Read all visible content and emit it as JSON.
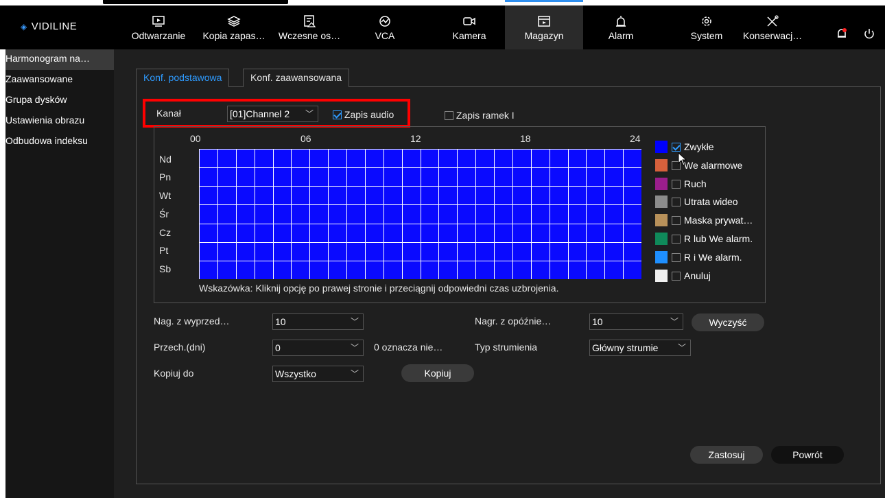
{
  "app": {
    "logo_text": "VIDILINE"
  },
  "nav": {
    "items": [
      {
        "label": "Odtwarzanie",
        "icon": "playback-icon"
      },
      {
        "label": "Kopia zapas…",
        "icon": "backup-icon"
      },
      {
        "label": "Wczesne os…",
        "icon": "early-warning-icon"
      },
      {
        "label": "VCA",
        "icon": "vca-icon"
      },
      {
        "label": "Kamera",
        "icon": "camera-icon"
      },
      {
        "label": "Magazyn",
        "icon": "storage-icon",
        "active": true
      },
      {
        "label": "Alarm",
        "icon": "alarm-icon"
      },
      {
        "label": "System",
        "icon": "system-gear-icon"
      },
      {
        "label": "Konserwacj…",
        "icon": "maintenance-tools-icon"
      }
    ],
    "notification_icon": "bell-icon",
    "power_icon": "power-icon"
  },
  "sidebar": {
    "items": [
      {
        "label": "Harmonogram na…",
        "selected": true
      },
      {
        "label": "Zaawansowane"
      },
      {
        "label": "Grupa dysków"
      },
      {
        "label": "Ustawienia obrazu"
      },
      {
        "label": "Odbudowa indeksu"
      }
    ]
  },
  "tabs": {
    "basic": "Konf. podstawowa",
    "advanced": "Konf. zaawansowana"
  },
  "channel": {
    "label": "Kanał",
    "value": "[01]Channel 2",
    "audio_label": "Zapis audio",
    "audio_checked": true,
    "iframe_label": "Zapis ramek I",
    "iframe_checked": false
  },
  "schedule": {
    "hours": [
      "00",
      "06",
      "12",
      "18",
      "24"
    ],
    "days": [
      "Nd",
      "Pn",
      "Wt",
      "Śr",
      "Cz",
      "Pt",
      "Sb"
    ],
    "hint": "Wskazówka: Kliknij opcję po prawej stronie i przeciągnij odpowiedni czas uzbrojenia.",
    "legend": [
      {
        "label": "Zwykłe",
        "color": "#0000ff",
        "checked": true
      },
      {
        "label": "We alarmowe",
        "color": "#d6603c",
        "checked": false
      },
      {
        "label": "Ruch",
        "color": "#9b1e8c",
        "checked": false
      },
      {
        "label": "Utrata wideo",
        "color": "#8c8c8c",
        "checked": false
      },
      {
        "label": "Maska prywat…",
        "color": "#b8915a",
        "checked": false
      },
      {
        "label": "R lub We alarm.",
        "color": "#0f8a5a",
        "checked": false
      },
      {
        "label": "R i We alarm.",
        "color": "#1e8fff",
        "checked": false
      },
      {
        "label": "Anuluj",
        "color": "#f0f0f0",
        "checked": false
      }
    ]
  },
  "settings": {
    "prerecord_label": "Nag. z wyprzed…",
    "prerecord_value": "10",
    "postrecord_label": "Nagr. z opóźnie…",
    "postrecord_value": "10",
    "clear_label": "Wyczyść",
    "retention_label": "Przech.(dni)",
    "retention_value": "0",
    "retention_note": "0 oznacza nie…",
    "stream_label": "Typ strumienia",
    "stream_value": "Główny strumie",
    "copy_to_label": "Kopiuj do",
    "copy_to_value": "Wszystko",
    "copy_button": "Kopiuj"
  },
  "footer": {
    "apply": "Zastosuj",
    "back": "Powrót"
  }
}
